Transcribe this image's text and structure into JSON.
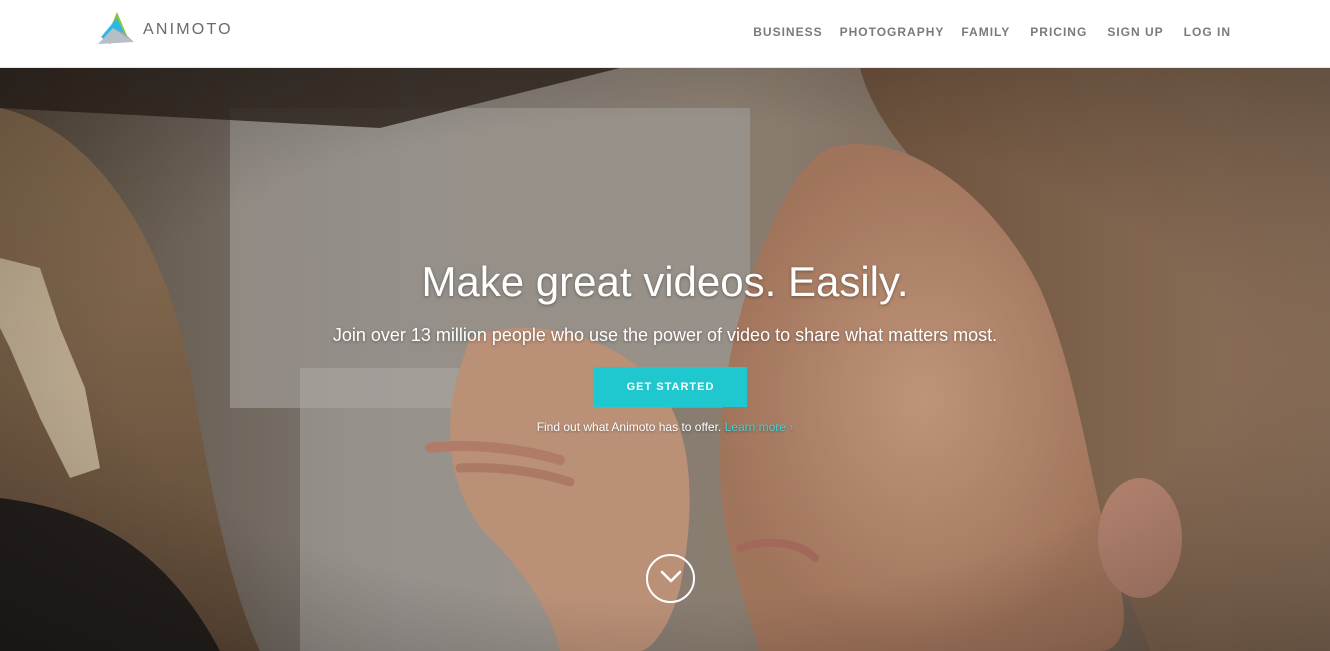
{
  "header": {
    "logo_text": "ANIMOTO",
    "nav": [
      {
        "label": "BUSINESS"
      },
      {
        "label": "PHOTOGRAPHY"
      },
      {
        "label": "FAMILY"
      },
      {
        "label": "PRICING"
      },
      {
        "label": "SIGN UP"
      },
      {
        "label": "LOG IN"
      }
    ]
  },
  "hero": {
    "title": "Make great videos. Easily.",
    "subtitle": "Join over 13 million people who use the power of video to share what matters most.",
    "cta_label": "GET STARTED",
    "learn_text": "Find out what Animoto has to offer.",
    "learn_link": "Learn more ›"
  },
  "colors": {
    "accent": "#1fc7cf",
    "nav_text": "#7a7a7a",
    "logo_text": "#6a6a6a"
  },
  "icons": {
    "logo": "animoto-logo-icon",
    "scroll": "chevron-down-circle-icon"
  }
}
